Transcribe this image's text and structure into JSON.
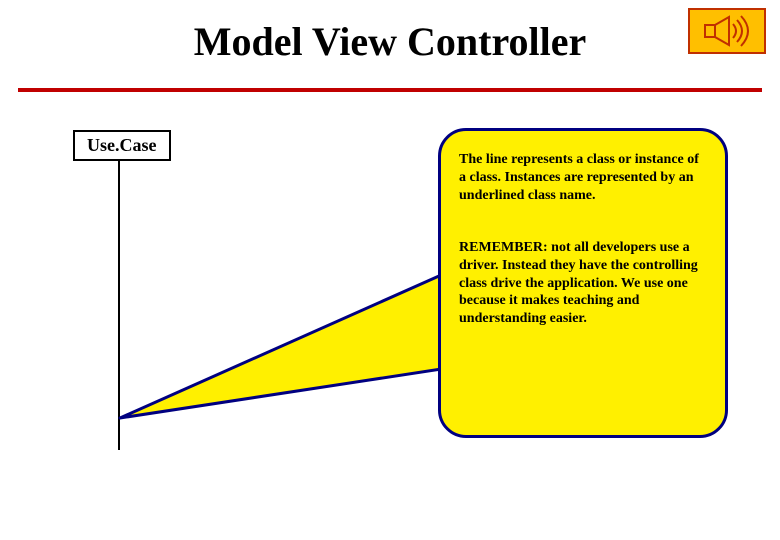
{
  "title": "Model View Controller",
  "usecase_label": "Use.Case",
  "callout": {
    "para1": "The line represents a class or instance of a class.  Instances are represented by an underlined class name.",
    "remember_label": "REMEMBER:",
    "para2": "  not all developers use a driver.  Instead they have the controlling class drive the application.  We use one because it makes teaching and understanding easier."
  },
  "colors": {
    "rule": "#c00000",
    "callout_fill": "#fff000",
    "callout_border": "#000080",
    "audio_fill": "#ffbf00",
    "audio_border": "#c03000"
  },
  "icons": {
    "audio": "speaker-icon"
  }
}
